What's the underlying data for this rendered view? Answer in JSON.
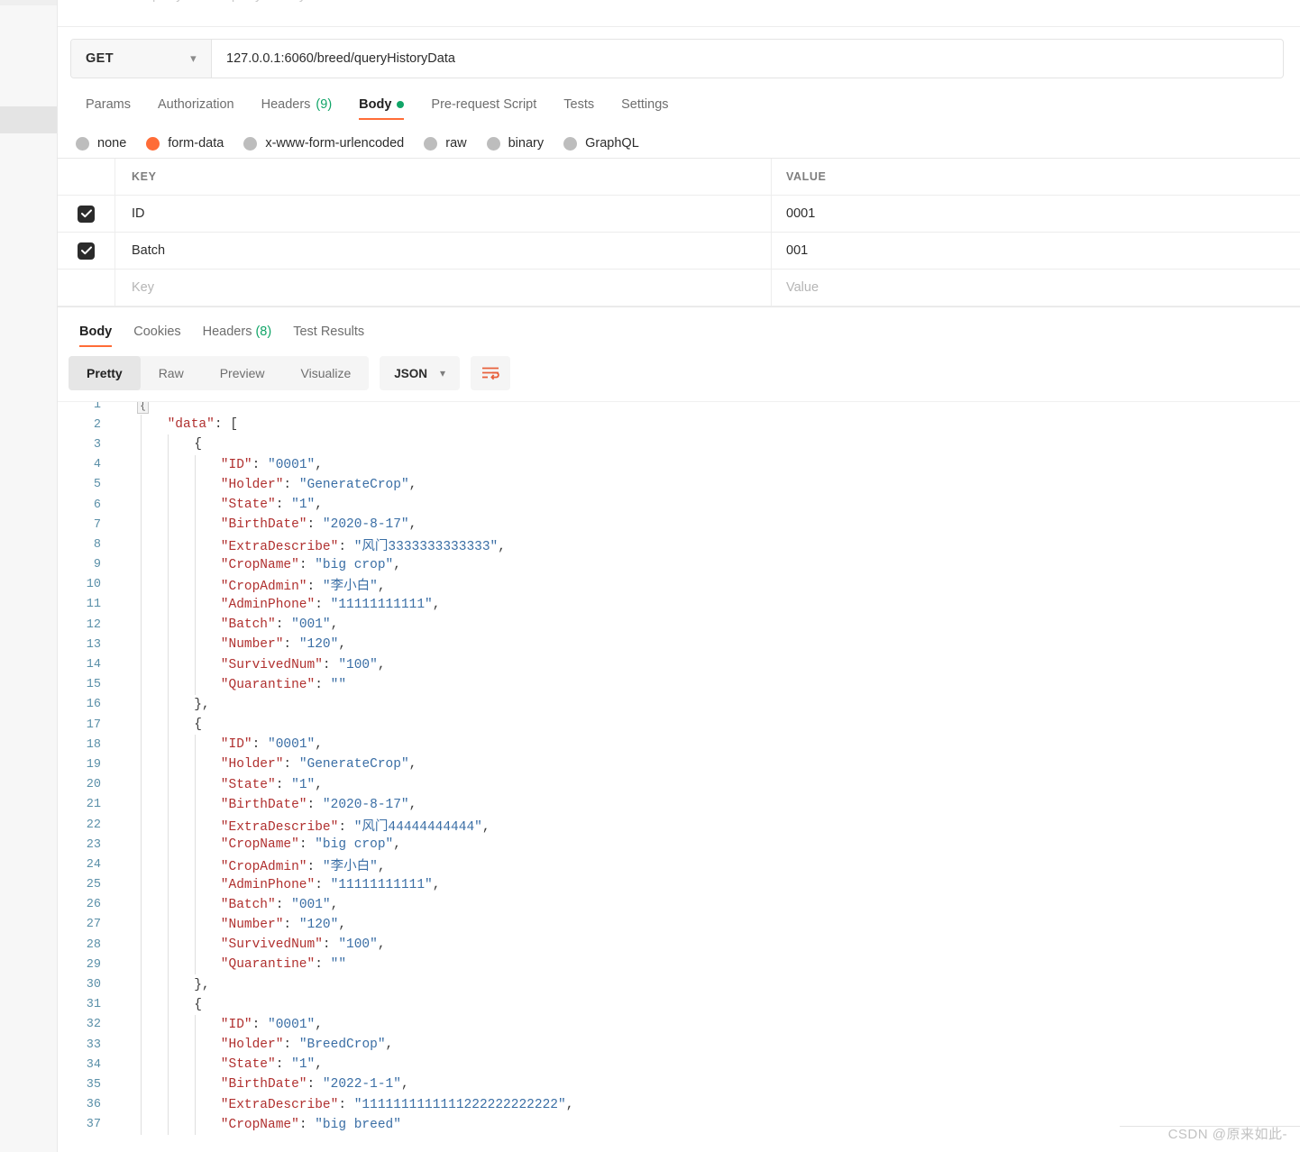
{
  "left_rail": {
    "name": "sidebar-rail"
  },
  "request": {
    "method": "GET",
    "method_chevron": "chevron-down-icon",
    "url": "127.0.0.1:6060/breed/queryHistoryData",
    "tabs": [
      {
        "label": "Params",
        "active": false,
        "count": "",
        "dot": false
      },
      {
        "label": "Authorization",
        "active": false,
        "count": "",
        "dot": false
      },
      {
        "label": "Headers",
        "active": false,
        "count": "(9)",
        "dot": false
      },
      {
        "label": "Body",
        "active": true,
        "count": "",
        "dot": true
      },
      {
        "label": "Pre-request Script",
        "active": false,
        "count": "",
        "dot": false
      },
      {
        "label": "Tests",
        "active": false,
        "count": "",
        "dot": false
      },
      {
        "label": "Settings",
        "active": false,
        "count": "",
        "dot": false
      }
    ],
    "body_types": [
      {
        "label": "none",
        "selected": false
      },
      {
        "label": "form-data",
        "selected": true
      },
      {
        "label": "x-www-form-urlencoded",
        "selected": false
      },
      {
        "label": "raw",
        "selected": false
      },
      {
        "label": "binary",
        "selected": false
      },
      {
        "label": "GraphQL",
        "selected": false
      }
    ],
    "table": {
      "headers": {
        "key": "KEY",
        "value": "VALUE"
      },
      "rows": [
        {
          "checked": true,
          "key": "ID",
          "value": "0001"
        },
        {
          "checked": true,
          "key": "Batch",
          "value": "001"
        }
      ],
      "placeholder_row": {
        "key": "Key",
        "value": "Value"
      }
    }
  },
  "response": {
    "tabs": [
      {
        "label": "Body",
        "active": true,
        "count": ""
      },
      {
        "label": "Cookies",
        "active": false,
        "count": ""
      },
      {
        "label": "Headers",
        "active": false,
        "count": "(8)"
      },
      {
        "label": "Test Results",
        "active": false,
        "count": ""
      }
    ],
    "view_modes": [
      {
        "label": "Pretty",
        "active": true
      },
      {
        "label": "Raw",
        "active": false
      },
      {
        "label": "Preview",
        "active": false
      },
      {
        "label": "Visualize",
        "active": false
      }
    ],
    "format": "JSON",
    "format_chevron": "chevron-down-icon",
    "wrap_icon": "word-wrap-icon",
    "fold_marker": "{",
    "code_lines": [
      {
        "n": 1,
        "indent": 0,
        "depth": 0,
        "segments": []
      },
      {
        "n": 2,
        "indent": 4,
        "depth": 1,
        "segments": [
          {
            "t": "k",
            "s": "\"data\""
          },
          {
            "t": "p",
            "s": ": ["
          }
        ]
      },
      {
        "n": 3,
        "indent": 8,
        "depth": 2,
        "segments": [
          {
            "t": "p",
            "s": "{"
          }
        ]
      },
      {
        "n": 4,
        "indent": 12,
        "depth": 3,
        "segments": [
          {
            "t": "k",
            "s": "\"ID\""
          },
          {
            "t": "p",
            "s": ": "
          },
          {
            "t": "v",
            "s": "\"0001\""
          },
          {
            "t": "p",
            "s": ","
          }
        ]
      },
      {
        "n": 5,
        "indent": 12,
        "depth": 3,
        "segments": [
          {
            "t": "k",
            "s": "\"Holder\""
          },
          {
            "t": "p",
            "s": ": "
          },
          {
            "t": "v",
            "s": "\"GenerateCrop\""
          },
          {
            "t": "p",
            "s": ","
          }
        ]
      },
      {
        "n": 6,
        "indent": 12,
        "depth": 3,
        "segments": [
          {
            "t": "k",
            "s": "\"State\""
          },
          {
            "t": "p",
            "s": ": "
          },
          {
            "t": "v",
            "s": "\"1\""
          },
          {
            "t": "p",
            "s": ","
          }
        ]
      },
      {
        "n": 7,
        "indent": 12,
        "depth": 3,
        "segments": [
          {
            "t": "k",
            "s": "\"BirthDate\""
          },
          {
            "t": "p",
            "s": ": "
          },
          {
            "t": "v",
            "s": "\"2020-8-17\""
          },
          {
            "t": "p",
            "s": ","
          }
        ]
      },
      {
        "n": 8,
        "indent": 12,
        "depth": 3,
        "segments": [
          {
            "t": "k",
            "s": "\"ExtraDescribe\""
          },
          {
            "t": "p",
            "s": ": "
          },
          {
            "t": "v",
            "s": "\"风门3333333333333\""
          },
          {
            "t": "p",
            "s": ","
          }
        ]
      },
      {
        "n": 9,
        "indent": 12,
        "depth": 3,
        "segments": [
          {
            "t": "k",
            "s": "\"CropName\""
          },
          {
            "t": "p",
            "s": ": "
          },
          {
            "t": "v",
            "s": "\"big crop\""
          },
          {
            "t": "p",
            "s": ","
          }
        ]
      },
      {
        "n": 10,
        "indent": 12,
        "depth": 3,
        "segments": [
          {
            "t": "k",
            "s": "\"CropAdmin\""
          },
          {
            "t": "p",
            "s": ": "
          },
          {
            "t": "v",
            "s": "\"李小白\""
          },
          {
            "t": "p",
            "s": ","
          }
        ]
      },
      {
        "n": 11,
        "indent": 12,
        "depth": 3,
        "segments": [
          {
            "t": "k",
            "s": "\"AdminPhone\""
          },
          {
            "t": "p",
            "s": ": "
          },
          {
            "t": "v",
            "s": "\"11111111111\""
          },
          {
            "t": "p",
            "s": ","
          }
        ]
      },
      {
        "n": 12,
        "indent": 12,
        "depth": 3,
        "segments": [
          {
            "t": "k",
            "s": "\"Batch\""
          },
          {
            "t": "p",
            "s": ": "
          },
          {
            "t": "v",
            "s": "\"001\""
          },
          {
            "t": "p",
            "s": ","
          }
        ]
      },
      {
        "n": 13,
        "indent": 12,
        "depth": 3,
        "segments": [
          {
            "t": "k",
            "s": "\"Number\""
          },
          {
            "t": "p",
            "s": ": "
          },
          {
            "t": "v",
            "s": "\"120\""
          },
          {
            "t": "p",
            "s": ","
          }
        ]
      },
      {
        "n": 14,
        "indent": 12,
        "depth": 3,
        "segments": [
          {
            "t": "k",
            "s": "\"SurvivedNum\""
          },
          {
            "t": "p",
            "s": ": "
          },
          {
            "t": "v",
            "s": "\"100\""
          },
          {
            "t": "p",
            "s": ","
          }
        ]
      },
      {
        "n": 15,
        "indent": 12,
        "depth": 3,
        "segments": [
          {
            "t": "k",
            "s": "\"Quarantine\""
          },
          {
            "t": "p",
            "s": ": "
          },
          {
            "t": "v",
            "s": "\"\""
          }
        ]
      },
      {
        "n": 16,
        "indent": 8,
        "depth": 2,
        "segments": [
          {
            "t": "p",
            "s": "},"
          }
        ]
      },
      {
        "n": 17,
        "indent": 8,
        "depth": 2,
        "segments": [
          {
            "t": "p",
            "s": "{"
          }
        ]
      },
      {
        "n": 18,
        "indent": 12,
        "depth": 3,
        "segments": [
          {
            "t": "k",
            "s": "\"ID\""
          },
          {
            "t": "p",
            "s": ": "
          },
          {
            "t": "v",
            "s": "\"0001\""
          },
          {
            "t": "p",
            "s": ","
          }
        ]
      },
      {
        "n": 19,
        "indent": 12,
        "depth": 3,
        "segments": [
          {
            "t": "k",
            "s": "\"Holder\""
          },
          {
            "t": "p",
            "s": ": "
          },
          {
            "t": "v",
            "s": "\"GenerateCrop\""
          },
          {
            "t": "p",
            "s": ","
          }
        ]
      },
      {
        "n": 20,
        "indent": 12,
        "depth": 3,
        "segments": [
          {
            "t": "k",
            "s": "\"State\""
          },
          {
            "t": "p",
            "s": ": "
          },
          {
            "t": "v",
            "s": "\"1\""
          },
          {
            "t": "p",
            "s": ","
          }
        ]
      },
      {
        "n": 21,
        "indent": 12,
        "depth": 3,
        "segments": [
          {
            "t": "k",
            "s": "\"BirthDate\""
          },
          {
            "t": "p",
            "s": ": "
          },
          {
            "t": "v",
            "s": "\"2020-8-17\""
          },
          {
            "t": "p",
            "s": ","
          }
        ]
      },
      {
        "n": 22,
        "indent": 12,
        "depth": 3,
        "segments": [
          {
            "t": "k",
            "s": "\"ExtraDescribe\""
          },
          {
            "t": "p",
            "s": ": "
          },
          {
            "t": "v",
            "s": "\"风门44444444444\""
          },
          {
            "t": "p",
            "s": ","
          }
        ]
      },
      {
        "n": 23,
        "indent": 12,
        "depth": 3,
        "segments": [
          {
            "t": "k",
            "s": "\"CropName\""
          },
          {
            "t": "p",
            "s": ": "
          },
          {
            "t": "v",
            "s": "\"big crop\""
          },
          {
            "t": "p",
            "s": ","
          }
        ]
      },
      {
        "n": 24,
        "indent": 12,
        "depth": 3,
        "segments": [
          {
            "t": "k",
            "s": "\"CropAdmin\""
          },
          {
            "t": "p",
            "s": ": "
          },
          {
            "t": "v",
            "s": "\"李小白\""
          },
          {
            "t": "p",
            "s": ","
          }
        ]
      },
      {
        "n": 25,
        "indent": 12,
        "depth": 3,
        "segments": [
          {
            "t": "k",
            "s": "\"AdminPhone\""
          },
          {
            "t": "p",
            "s": ": "
          },
          {
            "t": "v",
            "s": "\"11111111111\""
          },
          {
            "t": "p",
            "s": ","
          }
        ]
      },
      {
        "n": 26,
        "indent": 12,
        "depth": 3,
        "segments": [
          {
            "t": "k",
            "s": "\"Batch\""
          },
          {
            "t": "p",
            "s": ": "
          },
          {
            "t": "v",
            "s": "\"001\""
          },
          {
            "t": "p",
            "s": ","
          }
        ]
      },
      {
        "n": 27,
        "indent": 12,
        "depth": 3,
        "segments": [
          {
            "t": "k",
            "s": "\"Number\""
          },
          {
            "t": "p",
            "s": ": "
          },
          {
            "t": "v",
            "s": "\"120\""
          },
          {
            "t": "p",
            "s": ","
          }
        ]
      },
      {
        "n": 28,
        "indent": 12,
        "depth": 3,
        "segments": [
          {
            "t": "k",
            "s": "\"SurvivedNum\""
          },
          {
            "t": "p",
            "s": ": "
          },
          {
            "t": "v",
            "s": "\"100\""
          },
          {
            "t": "p",
            "s": ","
          }
        ]
      },
      {
        "n": 29,
        "indent": 12,
        "depth": 3,
        "segments": [
          {
            "t": "k",
            "s": "\"Quarantine\""
          },
          {
            "t": "p",
            "s": ": "
          },
          {
            "t": "v",
            "s": "\"\""
          }
        ]
      },
      {
        "n": 30,
        "indent": 8,
        "depth": 2,
        "segments": [
          {
            "t": "p",
            "s": "},"
          }
        ]
      },
      {
        "n": 31,
        "indent": 8,
        "depth": 2,
        "segments": [
          {
            "t": "p",
            "s": "{"
          }
        ]
      },
      {
        "n": 32,
        "indent": 12,
        "depth": 3,
        "segments": [
          {
            "t": "k",
            "s": "\"ID\""
          },
          {
            "t": "p",
            "s": ": "
          },
          {
            "t": "v",
            "s": "\"0001\""
          },
          {
            "t": "p",
            "s": ","
          }
        ]
      },
      {
        "n": 33,
        "indent": 12,
        "depth": 3,
        "segments": [
          {
            "t": "k",
            "s": "\"Holder\""
          },
          {
            "t": "p",
            "s": ": "
          },
          {
            "t": "v",
            "s": "\"BreedCrop\""
          },
          {
            "t": "p",
            "s": ","
          }
        ]
      },
      {
        "n": 34,
        "indent": 12,
        "depth": 3,
        "segments": [
          {
            "t": "k",
            "s": "\"State\""
          },
          {
            "t": "p",
            "s": ": "
          },
          {
            "t": "v",
            "s": "\"1\""
          },
          {
            "t": "p",
            "s": ","
          }
        ]
      },
      {
        "n": 35,
        "indent": 12,
        "depth": 3,
        "segments": [
          {
            "t": "k",
            "s": "\"BirthDate\""
          },
          {
            "t": "p",
            "s": ": "
          },
          {
            "t": "v",
            "s": "\"2022-1-1\""
          },
          {
            "t": "p",
            "s": ","
          }
        ]
      },
      {
        "n": 36,
        "indent": 12,
        "depth": 3,
        "segments": [
          {
            "t": "k",
            "s": "\"ExtraDescribe\""
          },
          {
            "t": "p",
            "s": ": "
          },
          {
            "t": "v",
            "s": "\"1111111111111222222222222\""
          },
          {
            "t": "p",
            "s": ","
          }
        ]
      },
      {
        "n": 37,
        "indent": 12,
        "depth": 3,
        "segments": [
          {
            "t": "k",
            "s": "\"CropName\""
          },
          {
            "t": "p",
            "s": ": "
          },
          {
            "t": "v",
            "s": "\"big breed\""
          }
        ]
      }
    ]
  },
  "watermark": "CSDN @原来如此-"
}
